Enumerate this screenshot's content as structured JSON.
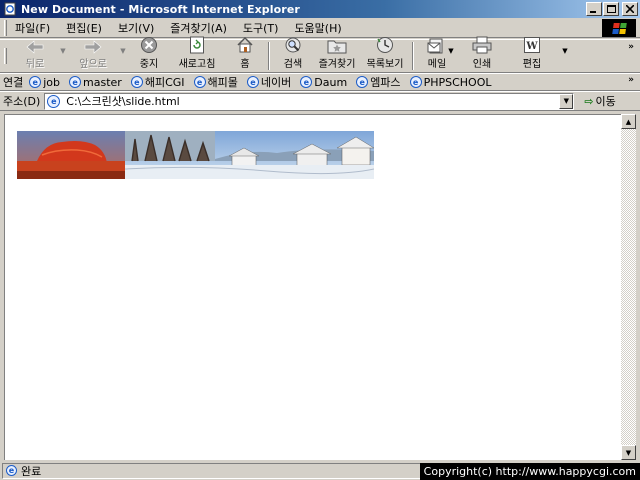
{
  "window": {
    "title": "New Document - Microsoft Internet Explorer",
    "controls": [
      "_",
      "□",
      "×"
    ]
  },
  "menu": [
    {
      "label": "파일(F)"
    },
    {
      "label": "편집(E)"
    },
    {
      "label": "보기(V)"
    },
    {
      "label": "즐겨찾기(A)"
    },
    {
      "label": "도구(T)"
    },
    {
      "label": "도움말(H)"
    }
  ],
  "toolbar": {
    "back": "뒤로",
    "forward": "앞으로",
    "stop": "중지",
    "refresh": "새로고침",
    "home": "홈",
    "search": "검색",
    "favorites": "즐겨찾기",
    "history": "목록보기",
    "mail": "메일",
    "print": "인쇄",
    "edit": "편집"
  },
  "links": {
    "label": "연결",
    "items": [
      "job",
      "master",
      "해피CGI",
      "해피몰",
      "네이버",
      "Daum",
      "엠파스",
      "PHPSCHOOL"
    ]
  },
  "address": {
    "label": "주소(D)",
    "url": "C:\\스크린샷\\slide.html",
    "go": "이동"
  },
  "status": {
    "text": "완료",
    "copyright": "Copyright(c) http://www.happycgi.com"
  },
  "icons": {
    "app": "ie-page-icon",
    "brand_colors": {
      "titlebar": "#0a246a",
      "ie_blue": "#1c5cc7",
      "go_green": "#1a7a1a"
    }
  }
}
